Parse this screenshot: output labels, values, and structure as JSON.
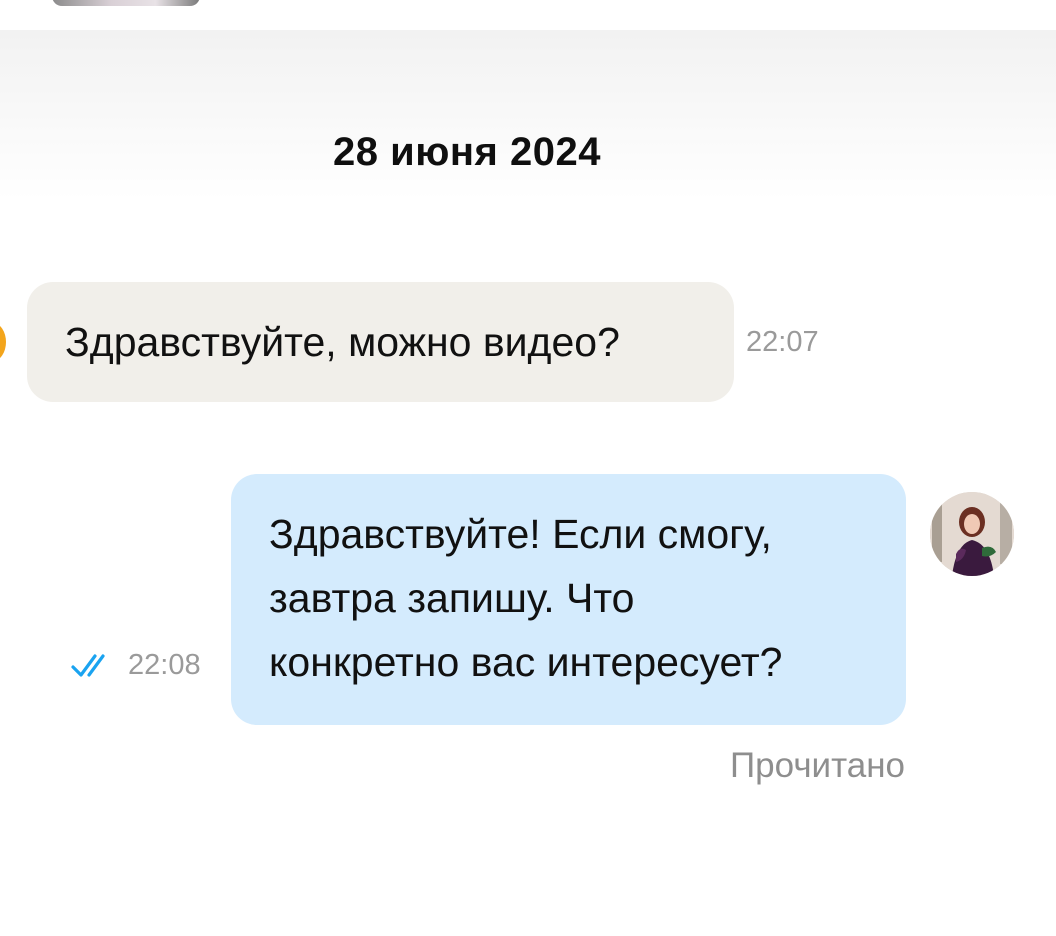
{
  "chat": {
    "date_separator": "28 июня 2024",
    "messages": [
      {
        "direction": "incoming",
        "text": "Здравствуйте, можно видео?",
        "time": "22:07"
      },
      {
        "direction": "outgoing",
        "lines": [
          "Здравствуйте! Если смогу,",
          "завтра запишу. Что",
          "конкретно вас интересует?"
        ],
        "time": "22:08",
        "status_icon": "double-check-icon",
        "read_label": "Прочитано"
      }
    ]
  },
  "colors": {
    "incoming_bubble": "#f1efea",
    "outgoing_bubble": "#d4ebfd",
    "check_marks": "#1aa3f0",
    "timestamp": "#9a9a9a"
  }
}
